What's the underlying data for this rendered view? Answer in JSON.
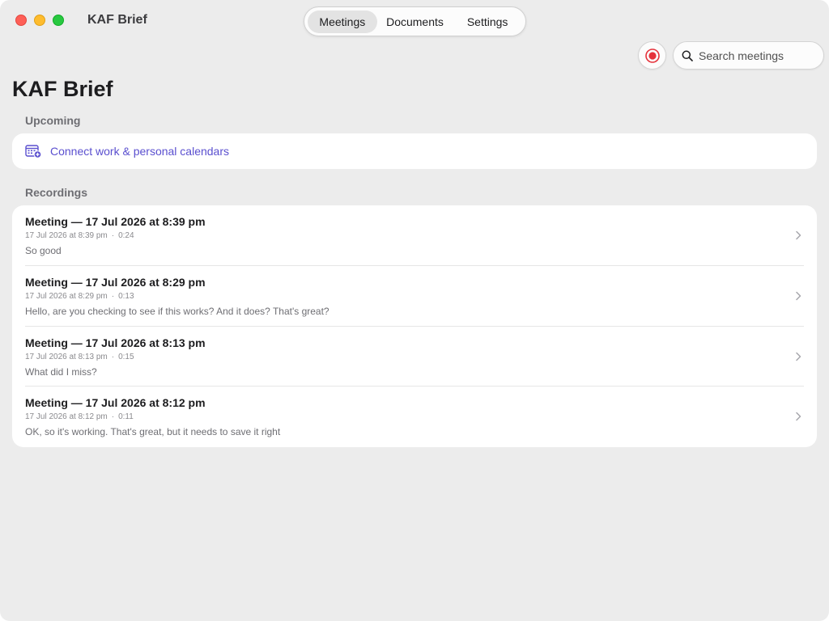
{
  "window": {
    "app_title": "KAF Brief"
  },
  "nav": {
    "tabs": [
      {
        "label": "Meetings",
        "active": true
      },
      {
        "label": "Documents",
        "active": false
      },
      {
        "label": "Settings",
        "active": false
      }
    ]
  },
  "toolbar": {
    "record_icon": "record-icon",
    "search_placeholder": "Search meetings",
    "search_value": ""
  },
  "page": {
    "title": "KAF Brief"
  },
  "upcoming": {
    "header": "Upcoming",
    "connect_label": "Connect work & personal calendars",
    "icon": "calendar-add-icon"
  },
  "recordings": {
    "header": "Recordings",
    "items": [
      {
        "title": "Meeting — 17 Jul 2026 at 8:39 pm",
        "date": "17 Jul 2026 at 8:39 pm",
        "duration": "0:24",
        "summary": "So good"
      },
      {
        "title": "Meeting — 17 Jul 2026 at 8:29 pm",
        "date": "17 Jul 2026 at 8:29 pm",
        "duration": "0:13",
        "summary": "Hello, are you checking to see if this works? And it does? That's great?"
      },
      {
        "title": "Meeting — 17 Jul 2026 at 8:13 pm",
        "date": "17 Jul 2026 at 8:13 pm",
        "duration": "0:15",
        "summary": "What did I miss?"
      },
      {
        "title": "Meeting — 17 Jul 2026 at 8:12 pm",
        "date": "17 Jul 2026 at 8:12 pm",
        "duration": "0:11",
        "summary": "OK, so it's working. That's great, but it needs to save it right"
      }
    ]
  },
  "colors": {
    "accent": "#5a4fcf",
    "record_red": "#e5323b",
    "background": "#ececec",
    "card": "#ffffff"
  }
}
